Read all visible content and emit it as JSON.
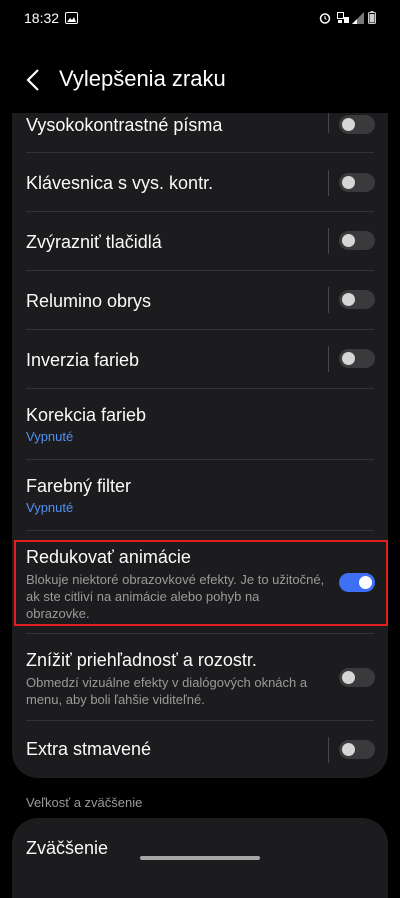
{
  "status": {
    "time": "18:32"
  },
  "header": {
    "title": "Vylepšenia zraku"
  },
  "settings": [
    {
      "title": "Vysokokontrastné písma",
      "enabled": false
    },
    {
      "title": "Klávesnica s vys. kontr.",
      "enabled": false
    },
    {
      "title": "Zvýrazniť tlačidlá",
      "enabled": false
    },
    {
      "title": "Relumino obrys",
      "enabled": false
    },
    {
      "title": "Inverzia farieb",
      "enabled": false
    },
    {
      "title": "Korekcia farieb",
      "subtitle": "Vypnuté"
    },
    {
      "title": "Farebný filter",
      "subtitle": "Vypnuté"
    },
    {
      "title": "Redukovať animácie",
      "description": "Blokuje niektoré obrazovkové efekty. Je to užitočné, ak ste citliví na animácie alebo pohyb na obrazovke.",
      "enabled": true
    },
    {
      "title": "Znížiť priehľadnosť a rozostr.",
      "description": "Obmedzí vizuálne efekty v dialógových oknách a menu, aby boli ľahšie viditeľné.",
      "enabled": false
    },
    {
      "title": "Extra stmavené",
      "enabled": false
    }
  ],
  "section": {
    "label": "Veľkosť a zväčšenie"
  },
  "next_item": {
    "title": "Zväčšenie"
  },
  "colors": {
    "accent": "#3e6ff4",
    "link": "#4f8ff7",
    "highlight": "#e0201e",
    "card": "#1c1c1e"
  }
}
